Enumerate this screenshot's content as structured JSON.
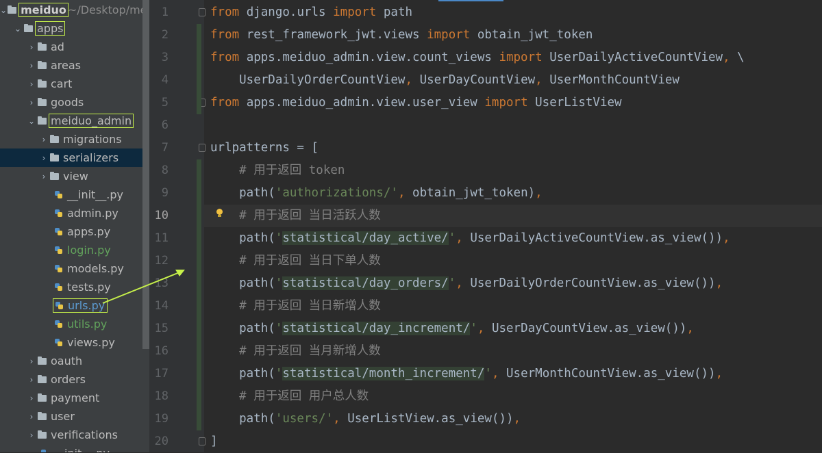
{
  "project_tree": {
    "root": {
      "name": "meiduo",
      "path": "~/Desktop/meid"
    },
    "items": [
      {
        "label": "apps"
      },
      {
        "label": "ad"
      },
      {
        "label": "areas"
      },
      {
        "label": "cart"
      },
      {
        "label": "goods"
      },
      {
        "label": "meiduo_admin"
      },
      {
        "label": "migrations"
      },
      {
        "label": "serializers"
      },
      {
        "label": "view"
      },
      {
        "label": "__init__.py"
      },
      {
        "label": "admin.py"
      },
      {
        "label": "apps.py"
      },
      {
        "label": "login.py"
      },
      {
        "label": "models.py"
      },
      {
        "label": "tests.py"
      },
      {
        "label": "urls.py"
      },
      {
        "label": "utils.py"
      },
      {
        "label": "views.py"
      },
      {
        "label": "oauth"
      },
      {
        "label": "orders"
      },
      {
        "label": "payment"
      },
      {
        "label": "user"
      },
      {
        "label": "verifications"
      },
      {
        "label": "__init__.py"
      }
    ]
  },
  "editor": {
    "current_line": 10,
    "line_numbers": [
      "1",
      "2",
      "3",
      "4",
      "5",
      "6",
      "7",
      "8",
      "9",
      "10",
      "11",
      "12",
      "13",
      "14",
      "15",
      "16",
      "17",
      "18",
      "19",
      "20"
    ],
    "lines": [
      {
        "parts": [
          [
            "kw",
            "from"
          ],
          [
            "t",
            " django.urls "
          ],
          [
            "kw",
            "import"
          ],
          [
            "t",
            " path"
          ]
        ]
      },
      {
        "parts": [
          [
            "kw",
            "from"
          ],
          [
            "t",
            " rest_framework_jwt.views "
          ],
          [
            "kw",
            "import"
          ],
          [
            "t",
            " obtain_jwt_token"
          ]
        ]
      },
      {
        "parts": [
          [
            "kw",
            "from"
          ],
          [
            "t",
            " apps.meiduo_admin.view.count_views "
          ],
          [
            "kw",
            "import"
          ],
          [
            "t",
            " UserDailyActiveCountView"
          ],
          [
            "kw",
            ","
          ],
          [
            "t",
            " \\"
          ]
        ]
      },
      {
        "parts": [
          [
            "t",
            "    UserDailyOrderCountView"
          ],
          [
            "kw",
            ","
          ],
          [
            "t",
            " UserDayCountView"
          ],
          [
            "kw",
            ","
          ],
          [
            "t",
            " UserMonthCountView"
          ]
        ]
      },
      {
        "parts": [
          [
            "kw",
            "from"
          ],
          [
            "t",
            " apps.meiduo_admin.view.user_view "
          ],
          [
            "kw",
            "import"
          ],
          [
            "t",
            " UserListView"
          ]
        ]
      },
      {
        "parts": []
      },
      {
        "parts": [
          [
            "t",
            "urlpatterns = ["
          ]
        ]
      },
      {
        "parts": [
          [
            "cm",
            "    # 用于返回 token"
          ]
        ]
      },
      {
        "parts": [
          [
            "t",
            "    path("
          ],
          [
            "str",
            "'authorizations/'"
          ],
          [
            "kw",
            ","
          ],
          [
            "t",
            " obtain_jwt_token)"
          ],
          [
            "kw",
            ","
          ]
        ]
      },
      {
        "parts": [
          [
            "cm",
            "    # 用于返回 当日活跃人数"
          ]
        ]
      },
      {
        "parts": [
          [
            "t",
            "    path("
          ],
          [
            "str",
            "'"
          ],
          [
            "strhl",
            "statistical/day_active/"
          ],
          [
            "str",
            "'"
          ],
          [
            "kw",
            ","
          ],
          [
            "t",
            " UserDailyActiveCountView.as_view())"
          ],
          [
            "kw",
            ","
          ]
        ]
      },
      {
        "parts": [
          [
            "cm",
            "    # 用于返回 当日下单人数"
          ]
        ]
      },
      {
        "parts": [
          [
            "t",
            "    path("
          ],
          [
            "str",
            "'"
          ],
          [
            "strhl",
            "statistical/day_orders/"
          ],
          [
            "str",
            "'"
          ],
          [
            "kw",
            ","
          ],
          [
            "t",
            " UserDailyOrderCountView.as_view())"
          ],
          [
            "kw",
            ","
          ]
        ]
      },
      {
        "parts": [
          [
            "cm",
            "    # 用于返回 当日新增人数"
          ]
        ]
      },
      {
        "parts": [
          [
            "t",
            "    path("
          ],
          [
            "str",
            "'"
          ],
          [
            "strhl",
            "statistical/day_increment/"
          ],
          [
            "str",
            "'"
          ],
          [
            "kw",
            ","
          ],
          [
            "t",
            " UserDayCountView.as_view())"
          ],
          [
            "kw",
            ","
          ]
        ]
      },
      {
        "parts": [
          [
            "cm",
            "    # 用于返回 当月新增人数"
          ]
        ]
      },
      {
        "parts": [
          [
            "t",
            "    path("
          ],
          [
            "str",
            "'"
          ],
          [
            "strhl",
            "statistical/month_increment/"
          ],
          [
            "str",
            "'"
          ],
          [
            "kw",
            ","
          ],
          [
            "t",
            " UserMonthCountView.as_view())"
          ],
          [
            "kw",
            ","
          ]
        ]
      },
      {
        "parts": [
          [
            "cm",
            "    # 用于返回 用户总人数"
          ]
        ]
      },
      {
        "parts": [
          [
            "t",
            "    path("
          ],
          [
            "str",
            "'users/'"
          ],
          [
            "kw",
            ","
          ],
          [
            "t",
            " UserListView.as_view())"
          ],
          [
            "kw",
            ","
          ]
        ]
      },
      {
        "parts": [
          [
            "t",
            "]"
          ]
        ]
      }
    ]
  },
  "colors": {
    "keyword": "#cc7832",
    "string": "#6a8759",
    "comment": "#808080",
    "text": "#a9b7c6",
    "annotation": "#c6f04a"
  }
}
